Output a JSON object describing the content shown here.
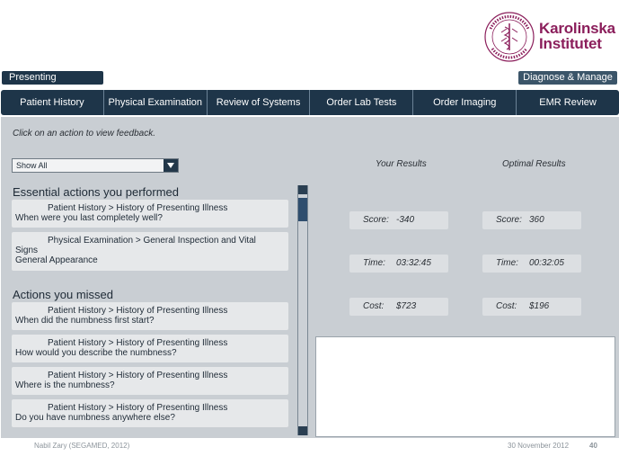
{
  "logo": {
    "line1": "Karolinska",
    "line2": "Institutet",
    "color": "#8b1e5b"
  },
  "tabs_top": {
    "left": "Presenting Complaint",
    "right": "Diagnose & Manage Pt."
  },
  "nav": [
    "Patient History",
    "Physical Examination",
    "Review of Systems",
    "Order Lab Tests",
    "Order Imaging",
    "EMR Review"
  ],
  "instruction": "Click on an action to view feedback.",
  "filter": {
    "selected": "Show All"
  },
  "columns": {
    "your": "Your Results",
    "optimal": "Optimal Results"
  },
  "results": {
    "your": {
      "score_label": "Score:",
      "score": "-340",
      "time_label": "Time:",
      "time": "03:32:45",
      "cost_label": "Cost:",
      "cost": "$723"
    },
    "optimal": {
      "score_label": "Score:",
      "score": "360",
      "time_label": "Time:",
      "time": "00:32:05",
      "cost_label": "Cost:",
      "cost": "$196"
    }
  },
  "performed": {
    "title": "Essential actions you performed",
    "items": [
      {
        "path": "Patient History > History of Presenting Illness",
        "question": "When were you last completely well?"
      },
      {
        "path1": "Physical Examination > General Inspection and Vital",
        "path2": "Signs",
        "question": "General Appearance"
      }
    ]
  },
  "missed": {
    "title": "Actions you missed",
    "items": [
      {
        "path": "Patient History > History of Presenting Illness",
        "question": "When did the numbness first start?"
      },
      {
        "path": "Patient History > History of Presenting Illness",
        "question": "How would you describe the numbness?"
      },
      {
        "path": "Patient History > History of Presenting Illness",
        "question": "Where is the numbness?"
      },
      {
        "path": "Patient History > History of Presenting Illness",
        "question": "Do you have numbness anywhere else?"
      }
    ]
  },
  "footer": {
    "author": "Nabil Zary (SEGAMED, 2012)",
    "date": "30 November 2012",
    "page": "40"
  }
}
